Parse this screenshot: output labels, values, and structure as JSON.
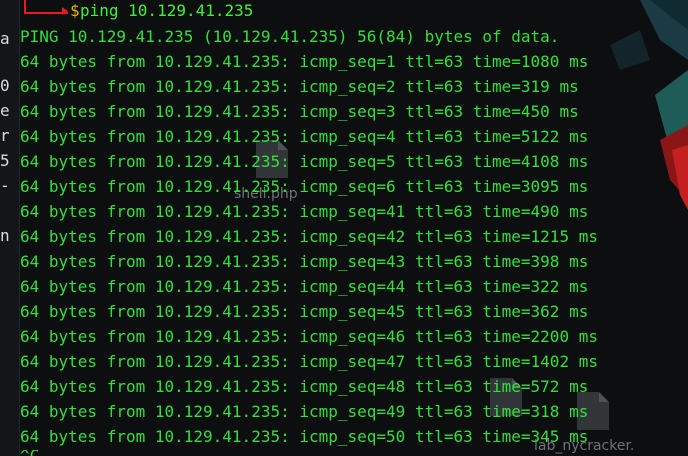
{
  "prompt": {
    "symbol": "$",
    "command": "ping 10.129.41.235"
  },
  "gutter_chars": [
    "a",
    "0",
    "e",
    "r",
    "5",
    "-",
    "",
    "n"
  ],
  "output": {
    "header": "PING 10.129.41.235 (10.129.41.235) 56(84) bytes of data.",
    "lines": [
      "64 bytes from 10.129.41.235: icmp_seq=1 ttl=63 time=1080 ms",
      "64 bytes from 10.129.41.235: icmp_seq=2 ttl=63 time=319 ms",
      "64 bytes from 10.129.41.235: icmp_seq=3 ttl=63 time=450 ms",
      "64 bytes from 10.129.41.235: icmp_seq=4 ttl=63 time=5122 ms",
      "64 bytes from 10.129.41.235: icmp_seq=5 ttl=63 time=4108 ms",
      "64 bytes from 10.129.41.235: icmp_seq=6 ttl=63 time=3095 ms",
      "64 bytes from 10.129.41.235: icmp_seq=41 ttl=63 time=490 ms",
      "64 bytes from 10.129.41.235: icmp_seq=42 ttl=63 time=1215 ms",
      "64 bytes from 10.129.41.235: icmp_seq=43 ttl=63 time=398 ms",
      "64 bytes from 10.129.41.235: icmp_seq=44 ttl=63 time=322 ms",
      "64 bytes from 10.129.41.235: icmp_seq=45 ttl=63 time=362 ms",
      "64 bytes from 10.129.41.235: icmp_seq=46 ttl=63 time=2200 ms",
      "64 bytes from 10.129.41.235: icmp_seq=47 ttl=63 time=1402 ms",
      "64 bytes from 10.129.41.235: icmp_seq=48 ttl=63 time=572 ms",
      "64 bytes from 10.129.41.235: icmp_seq=49 ttl=63 time=318 ms",
      "64 bytes from 10.129.41.235: icmp_seq=50 ttl=63 time=345 ms"
    ],
    "partial_last": "^C"
  },
  "desktop_icons": {
    "shell": {
      "label": "shell.php",
      "icon": "file-icon"
    },
    "lab": {
      "label": "lab_nycracker.",
      "icon": "file-icon"
    },
    "middle_icon": {
      "icon": "file-icon"
    }
  },
  "colors": {
    "prompt_corner": "#e51d1d",
    "prompt_symbol": "#e6b400",
    "command_text": "#3ff23a",
    "output_text": "#33e03a",
    "background": "#0c0e10"
  }
}
